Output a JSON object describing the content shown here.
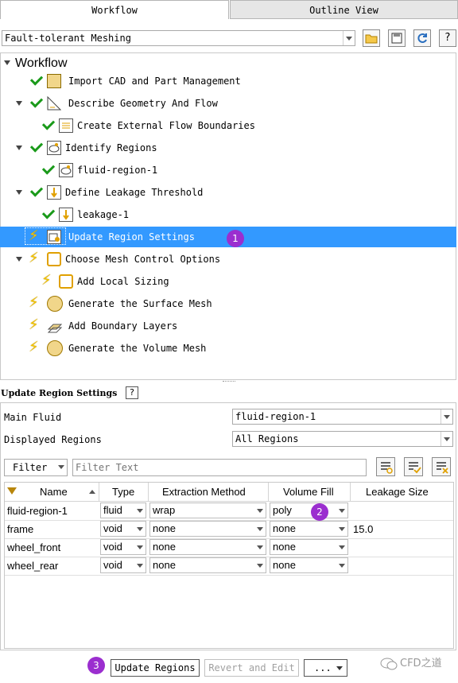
{
  "tabs": [
    {
      "label": "Workflow",
      "active": true
    },
    {
      "label": "Outline View",
      "active": false
    }
  ],
  "workflow_selector": {
    "value": "Fault-tolerant Meshing"
  },
  "toolbar_icons": [
    "open-folder-icon",
    "save-icon",
    "refresh-icon",
    "help-icon"
  ],
  "tree": {
    "root_label": "Workflow",
    "items": [
      {
        "label": "Import CAD and Part Management",
        "status": "done",
        "icon": "cad-icon",
        "level": 1,
        "expander": false
      },
      {
        "label": "Describe Geometry And Flow",
        "status": "done",
        "icon": "geometry-icon",
        "level": 1,
        "expander": true
      },
      {
        "label": "Create External Flow Boundaries",
        "status": "done",
        "icon": "boundaries-icon",
        "level": 2,
        "expander": false
      },
      {
        "label": "Identify Regions",
        "status": "done",
        "icon": "region-icon",
        "level": 1,
        "expander": true
      },
      {
        "label": "fluid-region-1",
        "status": "done",
        "icon": "region-icon",
        "level": 2,
        "expander": false
      },
      {
        "label": "Define Leakage Threshold",
        "status": "done",
        "icon": "leakage-icon",
        "level": 1,
        "expander": true
      },
      {
        "label": "leakage-1",
        "status": "done",
        "icon": "leakage-icon",
        "level": 2,
        "expander": false
      },
      {
        "label": "Update Region Settings",
        "status": "pending",
        "icon": "region-settings-icon",
        "level": 1,
        "expander": false,
        "selected": true
      },
      {
        "label": "Choose Mesh Control Options",
        "status": "pending",
        "icon": "mesh-control-icon",
        "level": 1,
        "expander": true
      },
      {
        "label": "Add Local Sizing",
        "status": "pending",
        "icon": "mesh-control-icon",
        "level": 2,
        "expander": false
      },
      {
        "label": "Generate the Surface Mesh",
        "status": "pending",
        "icon": "surface-mesh-icon",
        "level": 1,
        "expander": false
      },
      {
        "label": "Add Boundary Layers",
        "status": "pending",
        "icon": "boundary-layers-icon",
        "level": 1,
        "expander": false
      },
      {
        "label": "Generate the Volume Mesh",
        "status": "pending",
        "icon": "volume-mesh-icon",
        "level": 1,
        "expander": false
      }
    ]
  },
  "annotations": {
    "badge1": "1",
    "badge2": "2",
    "badge3": "3"
  },
  "settings": {
    "title": "Update Region Settings",
    "help_icon": "help-icon",
    "main_fluid_label": "Main Fluid",
    "main_fluid_value": "fluid-region-1",
    "displayed_regions_label": "Displayed Regions",
    "displayed_regions_value": "All Regions",
    "filter_button": "Filter",
    "filter_placeholder": "Filter Text",
    "filter_action_icons": [
      "filter-settings-icon",
      "check-all-icon",
      "clear-filter-icon"
    ]
  },
  "table": {
    "headers": [
      "Name",
      "Type",
      "Extraction Method",
      "Volume Fill",
      "Leakage Size"
    ],
    "rows": [
      {
        "name": "fluid-region-1",
        "type": "fluid",
        "extraction": "wrap",
        "fill": "poly",
        "leakage": ""
      },
      {
        "name": "frame",
        "type": "void",
        "extraction": "none",
        "fill": "none",
        "leakage": "15.0"
      },
      {
        "name": "wheel_front",
        "type": "void",
        "extraction": "none",
        "fill": "none",
        "leakage": ""
      },
      {
        "name": "wheel_rear",
        "type": "void",
        "extraction": "none",
        "fill": "none",
        "leakage": ""
      }
    ]
  },
  "buttons": {
    "update": "Update Regions",
    "revert": "Revert and Edit",
    "more": "..."
  },
  "watermark": "CFD之道",
  "colors": {
    "selection": "#3399ff",
    "check": "#1a9a1a",
    "pending": "#f2c300",
    "badge": "#9b2ecf"
  }
}
